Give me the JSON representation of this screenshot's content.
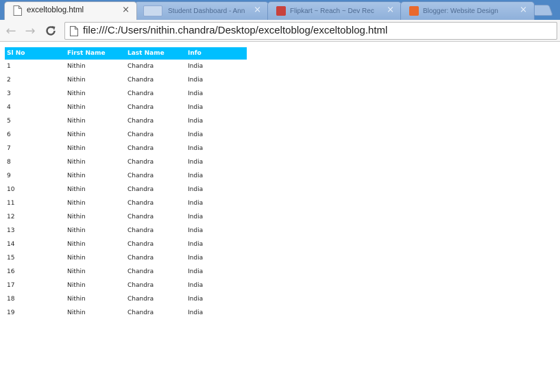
{
  "browser": {
    "tabs": [
      {
        "title": "exceltoblog.html",
        "close": "×",
        "active": true,
        "icon": "page-icon"
      },
      {
        "title": "Student Dashboard - Ann",
        "close": "×",
        "active": false,
        "icon": "blank-page-icon"
      },
      {
        "title": "Flipkart ~ Reach ~ Dev Rec",
        "close": "×",
        "active": false,
        "icon": "red-square-icon"
      },
      {
        "title": "Blogger: Website Design",
        "close": "×",
        "active": false,
        "icon": "blogger-icon"
      }
    ],
    "address_bar": {
      "url": "file:///C:/Users/nithin.chandra/Desktop/exceltoblog/exceltoblog.html"
    },
    "nav": {
      "back": "←",
      "forward": "→",
      "reload": "C"
    }
  },
  "table": {
    "headers": [
      "Sl No",
      "First Name",
      "Last Name",
      "Info"
    ],
    "header_color": "#00bfff",
    "rows": [
      [
        "1",
        "Nithin",
        "Chandra",
        "India"
      ],
      [
        "2",
        "Nithin",
        "Chandra",
        "India"
      ],
      [
        "3",
        "Nithin",
        "Chandra",
        "India"
      ],
      [
        "4",
        "Nithin",
        "Chandra",
        "India"
      ],
      [
        "5",
        "Nithin",
        "Chandra",
        "India"
      ],
      [
        "6",
        "Nithin",
        "Chandra",
        "India"
      ],
      [
        "7",
        "Nithin",
        "Chandra",
        "India"
      ],
      [
        "8",
        "Nithin",
        "Chandra",
        "India"
      ],
      [
        "9",
        "Nithin",
        "Chandra",
        "India"
      ],
      [
        "10",
        "Nithin",
        "Chandra",
        "India"
      ],
      [
        "11",
        "Nithin",
        "Chandra",
        "India"
      ],
      [
        "12",
        "Nithin",
        "Chandra",
        "India"
      ],
      [
        "13",
        "Nithin",
        "Chandra",
        "India"
      ],
      [
        "14",
        "Nithin",
        "Chandra",
        "India"
      ],
      [
        "15",
        "Nithin",
        "Chandra",
        "India"
      ],
      [
        "16",
        "Nithin",
        "Chandra",
        "India"
      ],
      [
        "17",
        "Nithin",
        "Chandra",
        "India"
      ],
      [
        "18",
        "Nithin",
        "Chandra",
        "India"
      ],
      [
        "19",
        "Nithin",
        "Chandra",
        "India"
      ]
    ]
  }
}
